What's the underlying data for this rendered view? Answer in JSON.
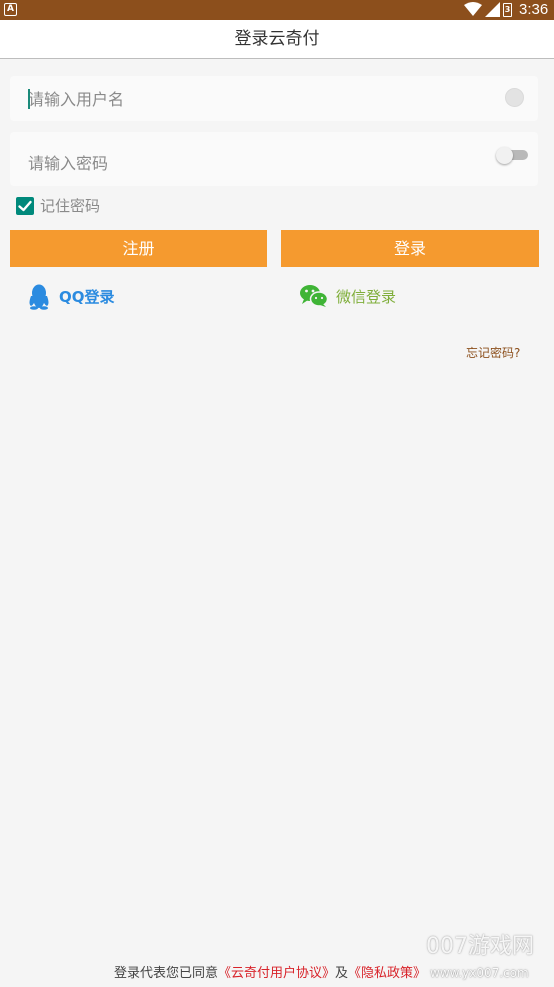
{
  "status_bar": {
    "app_icon_letter": "A",
    "battery_level": "3",
    "time": "3:36",
    "icons": [
      "app-notification-icon",
      "wifi-icon",
      "signal-icon",
      "battery-icon"
    ]
  },
  "header": {
    "title": "登录云奇付"
  },
  "form": {
    "username_placeholder": "请输入用户名",
    "password_placeholder": "请输入密码",
    "remember_label": "记住密码",
    "remember_checked": true,
    "register_label": "注册",
    "login_label": "登录"
  },
  "social": {
    "qq_label": "QQ登录",
    "wechat_label": "微信登录"
  },
  "forgot_password": "忘记密码?",
  "footer": {
    "prefix": "登录代表您已同意",
    "agreement_link": "《云奇付用户协议》",
    "conjunction": "及",
    "privacy_link": "《隐私政策》"
  },
  "watermark": {
    "brand": "007游戏网",
    "url": "www.yx007.com"
  },
  "colors": {
    "status_bar": "#8c4f1c",
    "accent_button": "#f59a2f",
    "checkbox": "#00897b",
    "qq_blue": "#2b8be0",
    "wechat_green": "#7fae3a",
    "link_red": "#d8232a",
    "forgot_brown": "#8c4f1c"
  }
}
